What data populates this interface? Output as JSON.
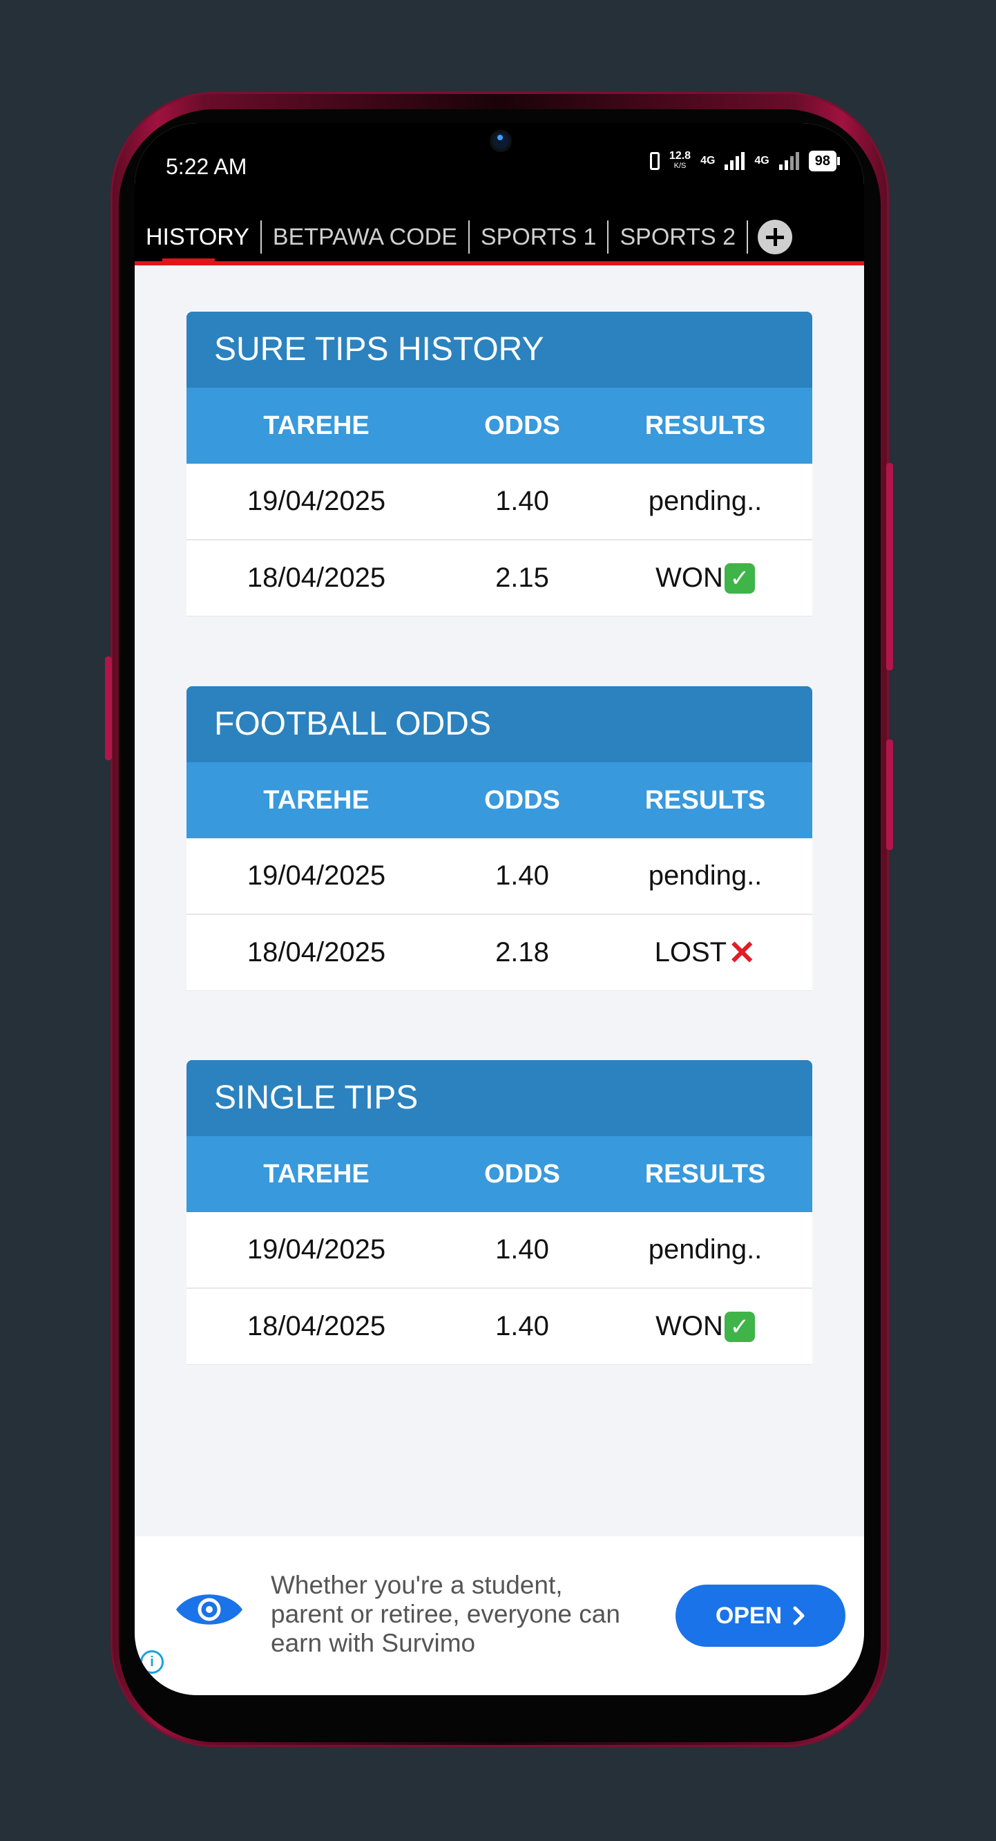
{
  "status_bar": {
    "time": "5:22 AM",
    "net_speed": "12.8",
    "net_unit": "K/S",
    "sim1": "4G",
    "sim2": "4G",
    "battery": "98"
  },
  "tabs": [
    {
      "label": "HISTORY",
      "active": true
    },
    {
      "label": "BETPAWA CODE"
    },
    {
      "label": "SPORTS 1"
    },
    {
      "label": "SPORTS 2"
    }
  ],
  "tables": [
    {
      "title": "SURE TIPS HISTORY",
      "headers": [
        "TAREHE",
        "ODDS",
        "RESULTS"
      ],
      "rows": [
        {
          "date": "19/04/2025",
          "odds": "1.40",
          "result": "pending.."
        },
        {
          "date": "18/04/2025",
          "odds": "2.15",
          "result": "WON"
        }
      ]
    },
    {
      "title": "FOOTBALL ODDS",
      "headers": [
        "TAREHE",
        "ODDS",
        "RESULTS"
      ],
      "rows": [
        {
          "date": "19/04/2025",
          "odds": "1.40",
          "result": "pending.."
        },
        {
          "date": "18/04/2025",
          "odds": "2.18",
          "result": "LOST"
        }
      ]
    },
    {
      "title": "SINGLE TIPS",
      "headers": [
        "TAREHE",
        "ODDS",
        "RESULTS"
      ],
      "rows": [
        {
          "date": "19/04/2025",
          "odds": "1.40",
          "result": "pending.."
        },
        {
          "date": "18/04/2025",
          "odds": "1.40",
          "result": "WON"
        }
      ]
    }
  ],
  "ad": {
    "text": "Whether you're a student, parent or retiree, everyone can earn with Survimo",
    "button": "OPEN",
    "colors": {
      "button": "#1a73e8"
    }
  },
  "colors": {
    "header_dark": "#2b82be",
    "header_light": "#3899dc",
    "tab_indicator": "#e0141b"
  }
}
